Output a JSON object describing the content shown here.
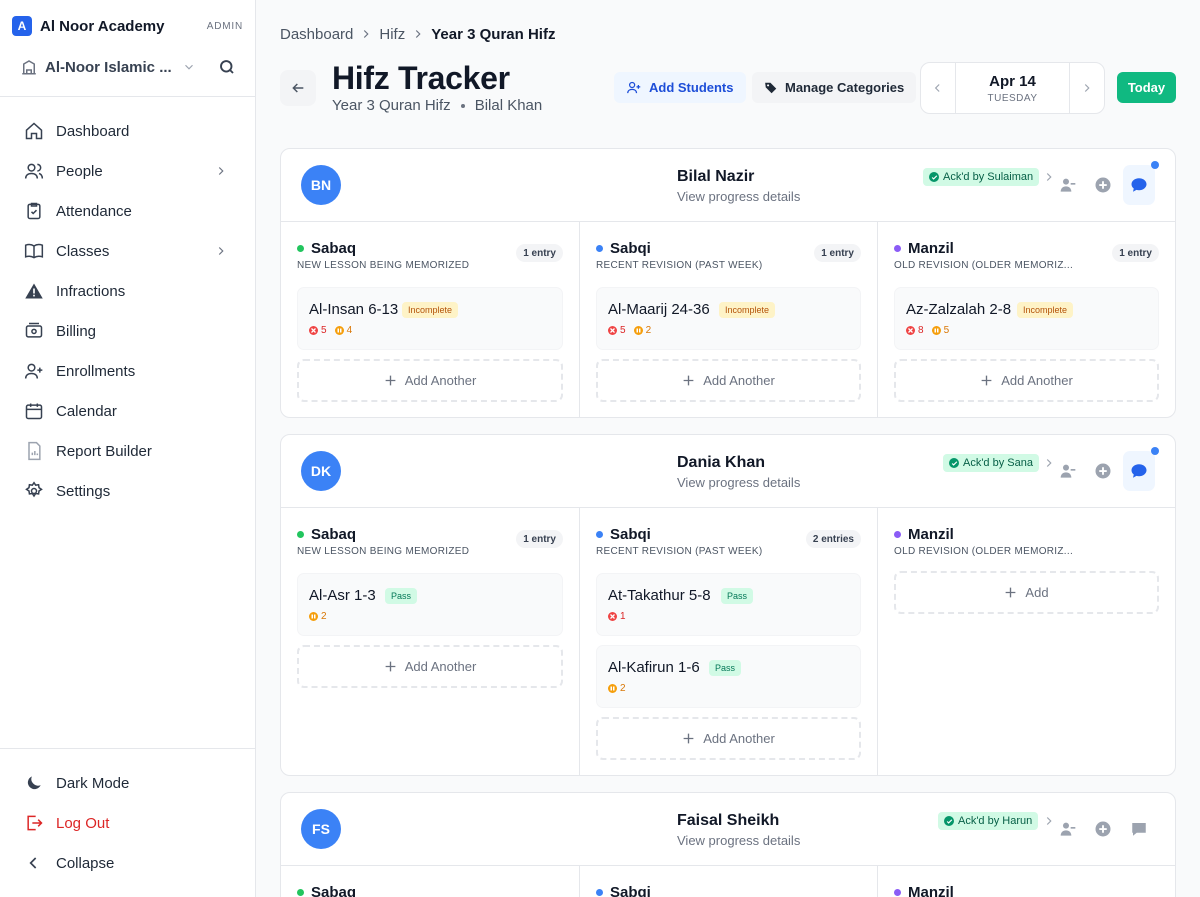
{
  "sidebar": {
    "brand": {
      "logo": "A",
      "name": "Al Noor Academy",
      "role": "ADMIN"
    },
    "org": {
      "name": "Al-Noor Islamic ..."
    },
    "nav": [
      {
        "label": "Dashboard",
        "icon": "home-icon"
      },
      {
        "label": "People",
        "icon": "users-icon",
        "has_children": true
      },
      {
        "label": "Attendance",
        "icon": "clipboard-check-icon"
      },
      {
        "label": "Classes",
        "icon": "book-icon",
        "has_children": true
      },
      {
        "label": "Infractions",
        "icon": "warning-icon"
      },
      {
        "label": "Billing",
        "icon": "money-icon"
      },
      {
        "label": "Enrollments",
        "icon": "user-plus-icon"
      },
      {
        "label": "Calendar",
        "icon": "calendar-icon"
      },
      {
        "label": "Report Builder",
        "icon": "report-icon"
      },
      {
        "label": "Settings",
        "icon": "gear-icon"
      }
    ],
    "bottom": {
      "dark_mode": "Dark Mode",
      "logout": "Log Out",
      "collapse": "Collapse"
    }
  },
  "breadcrumb": [
    "Dashboard",
    "Hifz",
    "Year 3 Quran Hifz"
  ],
  "header": {
    "title": "Hifz Tracker",
    "class_name": "Year 3 Quran Hifz",
    "teacher": "Bilal Khan",
    "add_students": "Add Students",
    "manage_categories": "Manage Categories",
    "date": "Apr 14",
    "weekday": "TUESDAY",
    "today": "Today"
  },
  "colors": {
    "sabaq": "#22c55e",
    "sabqi": "#3b82f6",
    "manzil": "#8b5cf6",
    "accent": "#10b981"
  },
  "categories": [
    {
      "name": "Sabaq",
      "desc": "NEW LESSON BEING MEMORIZED"
    },
    {
      "name": "Sabqi",
      "desc": "RECENT REVISION (PAST WEEK)"
    },
    {
      "name": "Manzil",
      "desc": "OLD REVISION (OLDER MEMORIZ..."
    }
  ],
  "students": [
    {
      "initials": "BN",
      "name": "Bilal Nazir",
      "link": "View progress details",
      "ack": "Ack'd by Sulaiman",
      "unread": true,
      "cols": [
        {
          "badge": "1 entry",
          "entries": [
            {
              "title": "Al-Insan 6-13",
              "status": "Incomplete",
              "errors": "5",
              "hesitations": "4"
            }
          ],
          "add": "Add Another"
        },
        {
          "badge": "1 entry",
          "entries": [
            {
              "title": "Al-Maarij 24-36",
              "status": "Incomplete",
              "errors": "5",
              "hesitations": "2"
            }
          ],
          "add": "Add Another"
        },
        {
          "badge": "1 entry",
          "entries": [
            {
              "title": "Az-Zalzalah 2-8",
              "status": "Incomplete",
              "errors": "8",
              "hesitations": "5"
            }
          ],
          "add": "Add Another"
        }
      ]
    },
    {
      "initials": "DK",
      "name": "Dania Khan",
      "link": "View progress details",
      "ack": "Ack'd by Sana",
      "unread": true,
      "cols": [
        {
          "badge": "1 entry",
          "entries": [
            {
              "title": "Al-Asr 1-3",
              "status": "Pass",
              "errors": "",
              "hesitations": "2"
            }
          ],
          "add": "Add Another"
        },
        {
          "badge": "2 entries",
          "entries": [
            {
              "title": "At-Takathur 5-8",
              "status": "Pass",
              "errors": "1",
              "hesitations": ""
            },
            {
              "title": "Al-Kafirun 1-6",
              "status": "Pass",
              "errors": "",
              "hesitations": "2"
            }
          ],
          "add": "Add Another"
        },
        {
          "badge": "",
          "entries": [],
          "add": "Add"
        }
      ]
    },
    {
      "initials": "FS",
      "name": "Faisal Sheikh",
      "link": "View progress details",
      "ack": "Ack'd by Harun",
      "unread": false,
      "cols": [
        {
          "badge": "",
          "entries": [],
          "add": ""
        },
        {
          "badge": "",
          "entries": [],
          "add": ""
        },
        {
          "badge": "",
          "entries": [],
          "add": ""
        }
      ]
    }
  ]
}
